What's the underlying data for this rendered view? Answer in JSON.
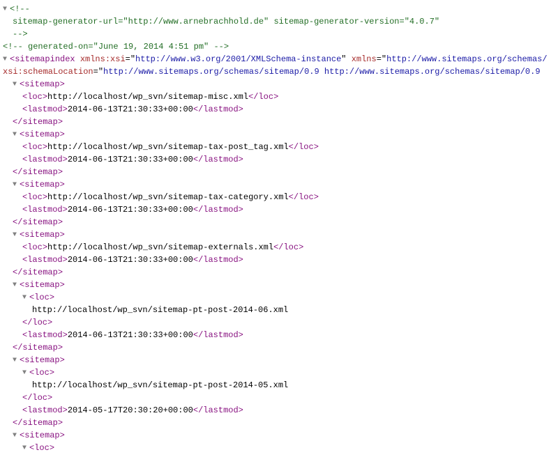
{
  "comment1_line1": "<!--",
  "comment1_line2": "  sitemap-generator-url=\"http://www.arnebrachhold.de\" sitemap-generator-version=\"4.0.7\"",
  "comment1_line3": "-->",
  "comment2": "<!--  generated-on=\"June 19, 2014 4:51 pm\"  -->",
  "root_open_1": "sitemapindex",
  "root_attr_k1": "xmlns:xsi",
  "root_attr_v1": "http://www.w3.org/2001/XMLSchema-instance",
  "root_attr_k2": "xmlns",
  "root_attr_v2": "http://www.sitemaps.org/schemas/",
  "root_attr_k3": "xsi:schemaLocation",
  "root_attr_v3": "http://www.sitemaps.org/schemas/sitemap/0.9 http://www.sitemaps.org/schemas/sitemap/0.9",
  "t_sitemap": "sitemap",
  "t_sitemap_close": "/sitemap",
  "t_loc": "loc",
  "t_loc_close": "/loc",
  "t_lastmod": "lastmod",
  "t_lastmod_close": "/lastmod",
  "s1_loc": "http://localhost/wp_svn/sitemap-misc.xml",
  "s1_lastmod": "2014-06-13T21:30:33+00:00",
  "s2_loc": "http://localhost/wp_svn/sitemap-tax-post_tag.xml",
  "s2_lastmod": "2014-06-13T21:30:33+00:00",
  "s3_loc": "http://localhost/wp_svn/sitemap-tax-category.xml",
  "s3_lastmod": "2014-06-13T21:30:33+00:00",
  "s4_loc": "http://localhost/wp_svn/sitemap-externals.xml",
  "s4_lastmod": "2014-06-13T21:30:33+00:00",
  "s5_loc": "http://localhost/wp_svn/sitemap-pt-post-2014-06.xml",
  "s5_lastmod": "2014-06-13T21:30:33+00:00",
  "s6_loc": "http://localhost/wp_svn/sitemap-pt-post-2014-05.xml",
  "s6_lastmod": "2014-05-17T20:30:20+00:00"
}
